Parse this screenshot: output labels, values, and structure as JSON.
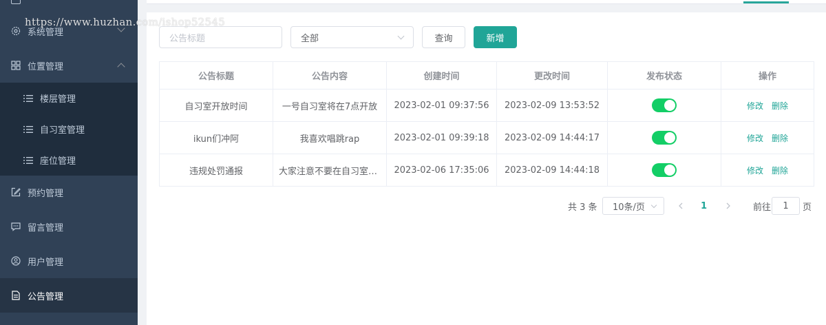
{
  "sidebar": {
    "items": [
      {
        "label": "系统管理",
        "icon": "gear-icon"
      },
      {
        "label": "位置管理",
        "icon": "grid-icon"
      },
      {
        "label": "楼层管理",
        "icon": "list-icon"
      },
      {
        "label": "自习室管理",
        "icon": "list-icon"
      },
      {
        "label": "座位管理",
        "icon": "list-icon"
      },
      {
        "label": "预约管理",
        "icon": "edit-icon"
      },
      {
        "label": "留言管理",
        "icon": "message-icon"
      },
      {
        "label": "用户管理",
        "icon": "user-icon"
      },
      {
        "label": "公告管理",
        "icon": "document-icon"
      }
    ],
    "active": "公告管理"
  },
  "search": {
    "title_placeholder": "公告标题",
    "status_value": "全部",
    "query_label": "查询",
    "add_label": "新增"
  },
  "table": {
    "headers": [
      "公告标题",
      "公告内容",
      "创建时间",
      "更改时间",
      "发布状态",
      "操作"
    ],
    "rows": [
      {
        "title": "自习室开放时间",
        "content": "一号自习室将在7点开放",
        "created": "2023-02-01 09:37:56",
        "updated": "2023-02-09 13:53:52",
        "published": true
      },
      {
        "title": "ikun们冲阿",
        "content": "我喜欢唱跳rap",
        "created": "2023-02-01 09:39:18",
        "updated": "2023-02-09 14:44:17",
        "published": true
      },
      {
        "title": "违规处罚通报",
        "content": "大家注意不要在自习室吃东西",
        "created": "2023-02-06 17:35:06",
        "updated": "2023-02-09 14:44:18",
        "published": true
      }
    ],
    "edit_label": "修改",
    "delete_label": "删除"
  },
  "pagination": {
    "total_text": "共 3 条",
    "page_size": "10条/页",
    "current_page": "1",
    "goto_label": "前往",
    "goto_value": "1",
    "page_unit": "页"
  },
  "watermark": "https://www.huzhan.com/ishop52545",
  "colors": {
    "accent": "#20a597",
    "switch_on": "#13ce66",
    "sidebar_bg": "#304156"
  }
}
